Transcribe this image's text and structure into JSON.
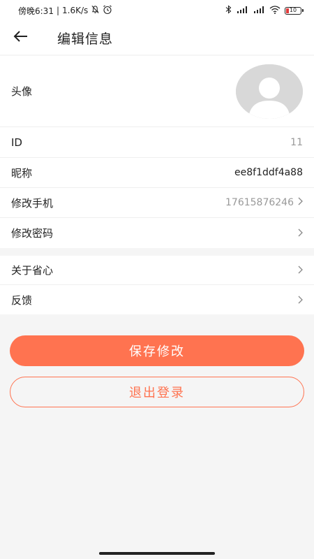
{
  "status_bar": {
    "time": "傍晚6:31",
    "speed": "1.6K/s",
    "battery": "10"
  },
  "header": {
    "title": "编辑信息"
  },
  "profile": {
    "avatar_label": "头像",
    "id_label": "ID",
    "id_value": "11",
    "nickname_label": "昵称",
    "nickname_value": "ee8f1ddf4a88",
    "phone_label": "修改手机",
    "phone_value": "17615876246",
    "password_label": "修改密码"
  },
  "misc": {
    "about_label": "关于省心",
    "feedback_label": "反馈"
  },
  "actions": {
    "save_label": "保存修改",
    "logout_label": "退出登录"
  },
  "colors": {
    "accent": "#ff7350",
    "background": "#f5f5f5"
  }
}
